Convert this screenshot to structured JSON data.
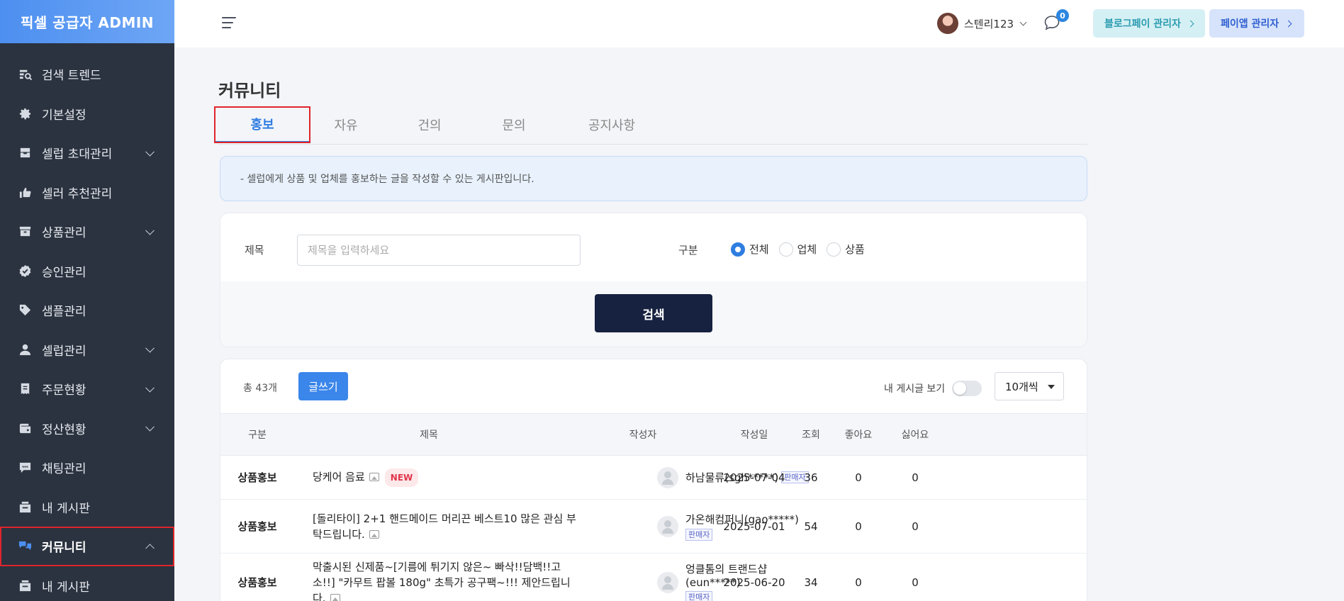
{
  "sidebar": {
    "brand": "픽셀 공급자 ADMIN",
    "items": [
      {
        "label": "검색 트렌드",
        "icon": "search-trend-icon",
        "chevron": ""
      },
      {
        "label": "기본설정",
        "icon": "gear-icon",
        "chevron": ""
      },
      {
        "label": "셀럽 초대관리",
        "icon": "inbox-icon",
        "chevron": "down"
      },
      {
        "label": "셀러 추천관리",
        "icon": "thumbs-up-icon",
        "chevron": ""
      },
      {
        "label": "상품관리",
        "icon": "archive-icon",
        "chevron": "down"
      },
      {
        "label": "승인관리",
        "icon": "badge-check-icon",
        "chevron": ""
      },
      {
        "label": "샘플관리",
        "icon": "tag-icon",
        "chevron": ""
      },
      {
        "label": "셀럽관리",
        "icon": "user-icon",
        "chevron": "down"
      },
      {
        "label": "주문현황",
        "icon": "receipt-icon",
        "chevron": "down"
      },
      {
        "label": "정산현황",
        "icon": "wallet-icon",
        "chevron": "down"
      },
      {
        "label": "채팅관리",
        "icon": "chat-icon",
        "chevron": ""
      },
      {
        "label": "내 게시판",
        "icon": "board-icon",
        "chevron": ""
      },
      {
        "label": "커뮤니티",
        "icon": "community-icon",
        "chevron": "up",
        "active": true
      },
      {
        "label": "내 게시판",
        "icon": "board-icon",
        "chevron": ""
      }
    ]
  },
  "header": {
    "username": "스텐리123",
    "chat_badge": "0",
    "blogpay_label": "블로그페이 관리자",
    "payapp_label": "페이앱 관리자"
  },
  "main": {
    "title": "커뮤니티",
    "tabs": [
      "홍보",
      "자유",
      "건의",
      "문의",
      "공지사항"
    ],
    "active_tab": "홍보",
    "notice": "-  셀럽에게 상품 및 업체를 홍보하는 글을 작성할 수 있는 게시판입니다."
  },
  "search": {
    "title_label": "제목",
    "title_placeholder": "제목을 입력하세요",
    "title_value": "",
    "category_label": "구분",
    "options": [
      "전체",
      "업체",
      "상품"
    ],
    "selected": "전체",
    "button_label": "검색"
  },
  "list": {
    "total": "총 43개",
    "write_label": "글쓰기",
    "my_posts_label": "내 게시글 보기",
    "my_posts_on": false,
    "per_page": "10개씩",
    "columns": [
      "구분",
      "제목",
      "작성자",
      "작성일",
      "조회",
      "좋아요",
      "싫어요"
    ],
    "rows": [
      {
        "category": "상품홍보",
        "title": "당케어 음료",
        "has_image": true,
        "is_new": true,
        "new_label": "NEW",
        "author": "하남물류(sgh*****)",
        "seller_badge": "판매자",
        "date": "2025-07-04",
        "views": "36",
        "likes": "0",
        "dislikes": "0"
      },
      {
        "category": "상품홍보",
        "title": "[돌리타이] 2+1 핸드메이드 머리끈 베스트10 많은 관심 부탁드립니다.",
        "has_image": true,
        "is_new": false,
        "author": "가온해컴퍼니(gao*****)",
        "seller_badge": "판매자",
        "date": "2025-07-01",
        "views": "54",
        "likes": "0",
        "dislikes": "0"
      },
      {
        "category": "상품홍보",
        "title": "막출시된 신제품~[기름에 튀기지 않은~ 빠삭!!담백!!고소!!] \"카무트 팝볼 180g\" 초특가 공구팩~!!! 제안드립니다.",
        "has_image": true,
        "is_new": false,
        "author": "엉클톰의 트랜드샵(eun*****)",
        "seller_badge": "판매자",
        "date": "2025-06-20",
        "views": "34",
        "likes": "0",
        "dislikes": "0"
      }
    ]
  },
  "colors": {
    "sidebar_bg": "#2b3340",
    "brand": "#4d8ff0",
    "accent": "#2f7de1",
    "search_button": "#172241",
    "highlight_outline": "#e0252b"
  }
}
